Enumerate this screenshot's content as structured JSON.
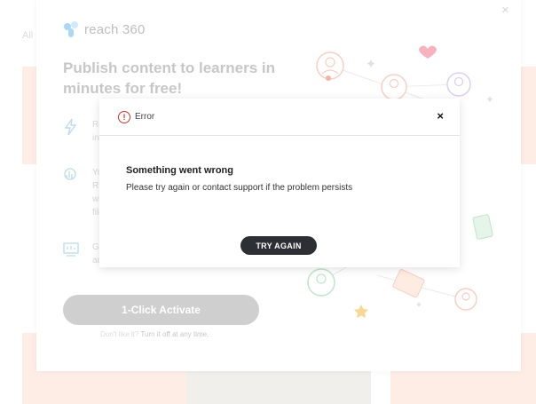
{
  "background": {
    "tab_label": "All"
  },
  "promo": {
    "close_glyph": "×",
    "logo_text": "reach 360",
    "headline": "Publish content to learners in minutes for free!",
    "features": [
      {
        "icon": "lightning-icon",
        "text_lines": [
          "Re",
          "int"
        ]
      },
      {
        "icon": "hand-icon",
        "text_lines": [
          "Yo",
          "Ris",
          "wi",
          "file"
        ]
      },
      {
        "icon": "dashboard-icon",
        "text_lines": [
          "Ge",
          "ac"
        ]
      }
    ],
    "activate_label": "1-Click Activate",
    "footnote_prefix": "Don't like it?",
    "footnote_link": "Turn it off at any time."
  },
  "error": {
    "icon_glyph": "!",
    "title": "Error",
    "close_glyph": "×",
    "heading": "Something went wrong",
    "message": "Please try again or contact support if the problem persists",
    "button_label": "TRY AGAIN"
  },
  "colors": {
    "accent_dark": "#2c2f33",
    "error_red": "#c0392b",
    "logo_blue": "#7ec4f2",
    "bg_peach": "#fde3d8"
  }
}
